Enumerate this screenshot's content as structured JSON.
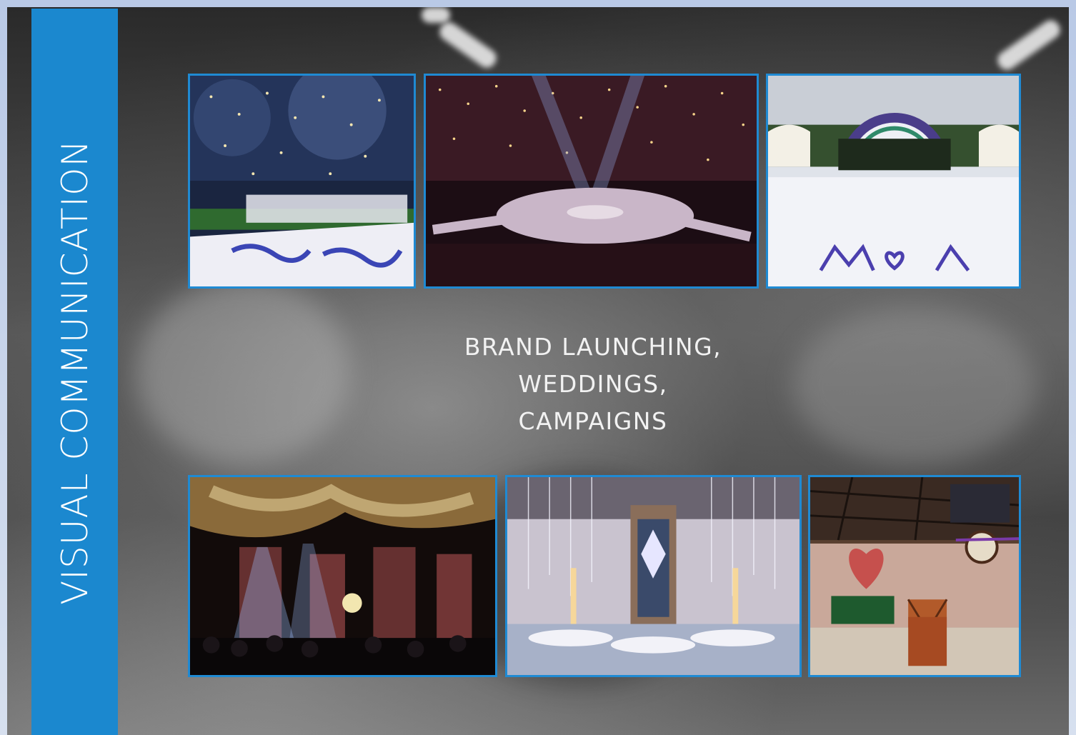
{
  "sidebar": {
    "title": "VISUAL COMMUNICATION"
  },
  "caption": {
    "lines": [
      "BRAND LAUNCHING,",
      "WEDDINGS,",
      "CAMPAIGNS"
    ]
  },
  "photos": [
    {
      "name": "outdoor-garden-wedding-photo",
      "icon": "photo-icon"
    },
    {
      "name": "starry-stage-event-photo",
      "icon": "photo-icon"
    },
    {
      "name": "monogram-dance-floor-photo",
      "icon": "photo-icon"
    },
    {
      "name": "concert-stage-lights-photo",
      "icon": "photo-icon"
    },
    {
      "name": "crystal-ballroom-photo",
      "icon": "photo-icon"
    },
    {
      "name": "industrial-venue-photo",
      "icon": "photo-icon"
    }
  ],
  "colors": {
    "accent": "#1b88cf",
    "border": "#1f8ad3"
  }
}
